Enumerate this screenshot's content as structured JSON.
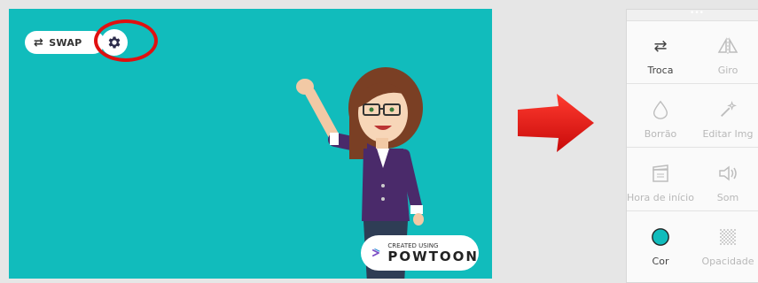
{
  "canvas": {
    "swap_label": "SWAP",
    "background_color": "#11bcbc",
    "badge": {
      "small": "CREATED USING",
      "big": "POWTOON"
    }
  },
  "highlight_color": "#e01010",
  "panel": {
    "rows": [
      [
        {
          "label": "Troca",
          "icon": "swap-icon",
          "enabled": true
        },
        {
          "label": "Giro",
          "icon": "flip-icon",
          "enabled": false
        }
      ],
      [
        {
          "label": "Borrão",
          "icon": "drop-icon",
          "enabled": false
        },
        {
          "label": "Editar Img",
          "icon": "magic-wand-icon",
          "enabled": false
        }
      ],
      [
        {
          "label": "Hora de início",
          "icon": "clapper-icon",
          "enabled": false
        },
        {
          "label": "Som",
          "icon": "speaker-icon",
          "enabled": false
        }
      ],
      [
        {
          "label": "Cor",
          "icon": "color-dot-icon",
          "enabled": true
        },
        {
          "label": "Opacidade",
          "icon": "checker-icon",
          "enabled": false
        }
      ]
    ]
  }
}
